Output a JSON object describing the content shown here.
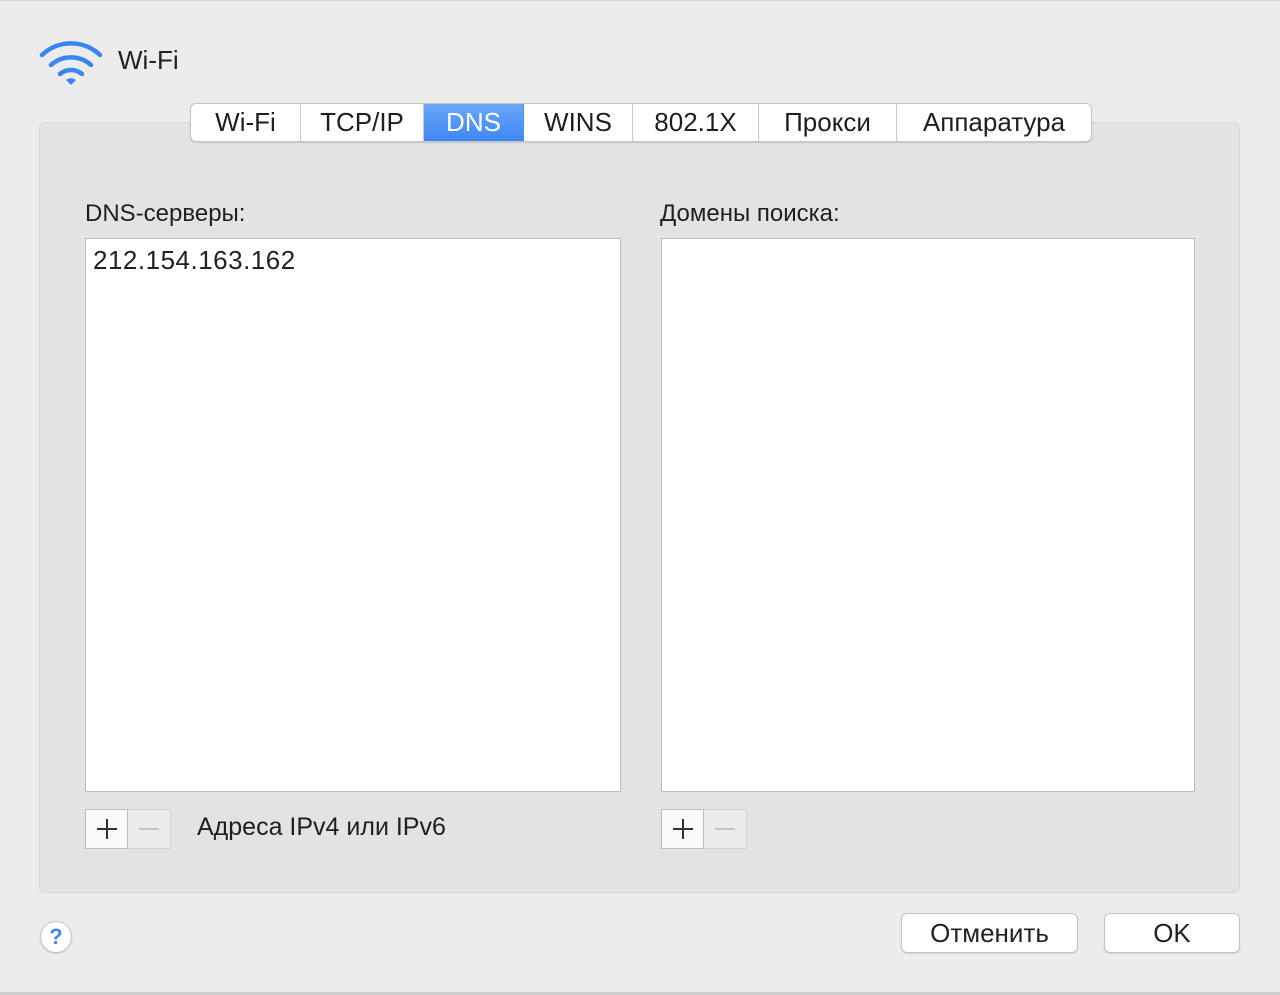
{
  "header": {
    "title": "Wi-Fi",
    "icon": "wifi-icon"
  },
  "tabs": [
    {
      "label": "Wi-Fi",
      "active": false
    },
    {
      "label": "TCP/IP",
      "active": false
    },
    {
      "label": "DNS",
      "active": true
    },
    {
      "label": "WINS",
      "active": false
    },
    {
      "label": "802.1X",
      "active": false
    },
    {
      "label": "Прокси",
      "active": false
    },
    {
      "label": "Аппаратура",
      "active": false
    }
  ],
  "dns": {
    "label": "DNS-серверы:",
    "servers": [
      "212.154.163.162"
    ],
    "hint": "Адреса IPv4 или IPv6",
    "add_symbol": "+",
    "remove_symbol": "−"
  },
  "search_domains": {
    "label": "Домены поиска:",
    "domains": []
  },
  "footer": {
    "help_symbol": "?",
    "cancel_label": "Отменить",
    "ok_label": "OK"
  },
  "colors": {
    "accent": "#3f87f3",
    "window_bg": "#ececec",
    "panel_bg": "#e3e3e3"
  }
}
